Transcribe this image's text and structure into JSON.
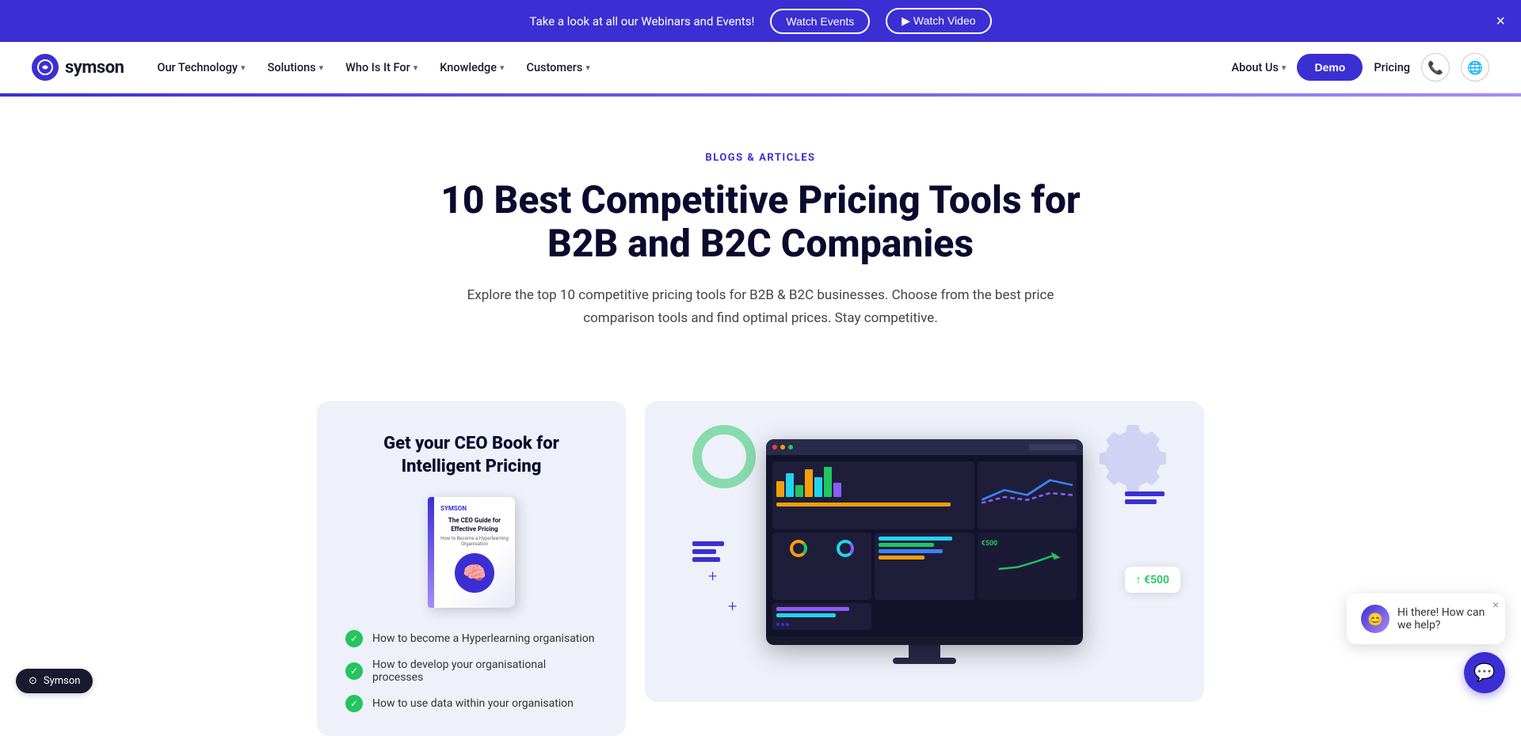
{
  "banner": {
    "text": "Take a look at all our Webinars and Events!",
    "watch_events_label": "Watch Events",
    "watch_video_label": "▶ Watch Video",
    "close_label": "×"
  },
  "navbar": {
    "logo_text": "symson",
    "logo_initial": "s",
    "nav_items": [
      {
        "label": "Our Technology",
        "has_dropdown": true
      },
      {
        "label": "Solutions",
        "has_dropdown": true
      },
      {
        "label": "Who Is It For",
        "has_dropdown": true
      },
      {
        "label": "Knowledge",
        "has_dropdown": true
      },
      {
        "label": "Customers",
        "has_dropdown": true
      }
    ],
    "about_label": "About Us",
    "demo_label": "Demo",
    "pricing_label": "Pricing"
  },
  "hero": {
    "category": "BLOGS & ARTICLES",
    "title": "10 Best Competitive Pricing Tools for B2B and B2C Companies",
    "description": "Explore the top 10 competitive pricing tools for B2B & B2C businesses. Choose from the best price comparison tools and find optimal prices. Stay competitive."
  },
  "ceo_card": {
    "title": "Get your CEO Book for Intelligent Pricing",
    "book_logo": "SYMSON",
    "book_title": "The CEO Guide for Effective Pricing",
    "book_subtitle": "How to Become a Hyperlearning Organisation",
    "checklist": [
      "How to become a Hyperlearning organisation",
      "How to develop your organisational processes",
      "How to use data within your organisation"
    ]
  },
  "chat": {
    "message": "Hi there! How can we help?",
    "toggle_label": "Symson"
  },
  "colors": {
    "primary": "#3b2fd4",
    "success": "#22c55e",
    "background": "#eef0fa",
    "dark": "#0a0a2e"
  }
}
